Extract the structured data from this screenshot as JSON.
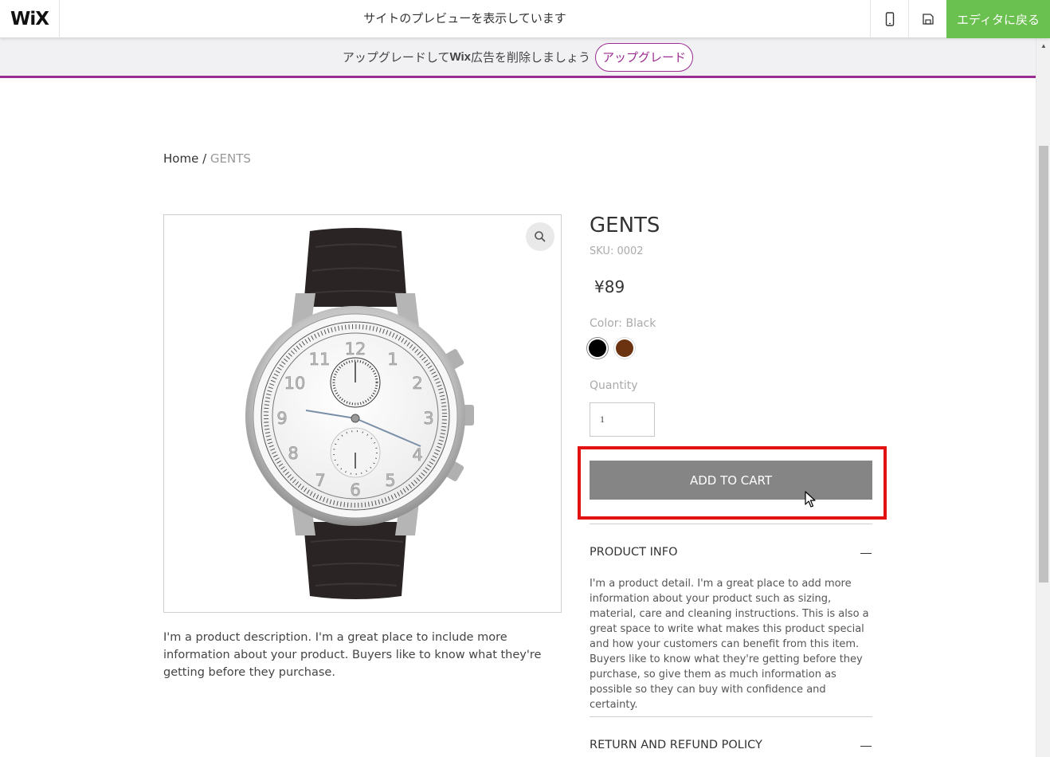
{
  "topbar": {
    "logo": "WiX",
    "preview_text": "サイトのプレビューを表示しています",
    "back_to_editor": "エディタに戻る",
    "accent_color": "#6bc14f"
  },
  "banner": {
    "text_before": "アップグレードして ",
    "text_brand": "Wix",
    "text_after": " 広告を削除しましょう",
    "upgrade_label": "アップグレード",
    "accent_color": "#9b2c91"
  },
  "breadcrumb": {
    "home": "Home",
    "separator": "/",
    "current": "GENTS"
  },
  "product": {
    "title": "GENTS",
    "sku": "SKU: 0002",
    "price": "¥89",
    "color_label": "Color: Black",
    "colors": [
      {
        "name": "Black",
        "hex": "#000000"
      },
      {
        "name": "Brown",
        "hex": "#6b3310"
      }
    ],
    "quantity_label": "Quantity",
    "quantity_value": "1",
    "add_to_cart": "ADD TO CART",
    "description": "I'm a product description. I'm a great place to include more information about your product. Buyers like to know what they're getting before they purchase."
  },
  "sections": {
    "product_info_title": "PRODUCT INFO",
    "product_info_text": "I'm a product detail. I'm a great place to add more information about your product such as sizing, material, care and cleaning instructions. This is also a great space to write what makes this product special and how your customers can benefit from this item. Buyers like to know what they're getting before they purchase, so give them as much information as possible so they can buy with confidence and certainty.",
    "return_policy_title": "RETURN AND REFUND POLICY"
  },
  "icons": {
    "mobile": "mobile-phone-icon",
    "save": "save-disk-icon",
    "zoom": "magnifier-icon",
    "collapse": "minus-icon"
  }
}
